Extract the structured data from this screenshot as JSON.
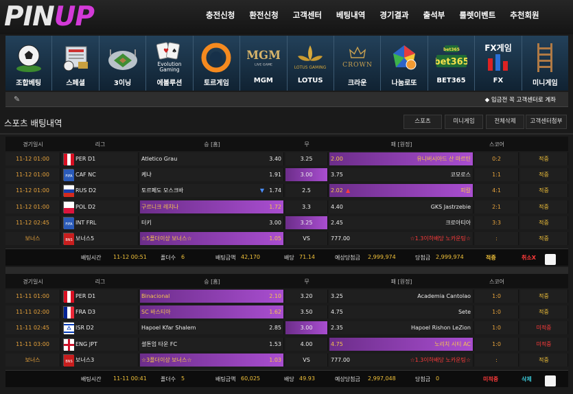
{
  "logo": {
    "part1": "PIN",
    "part2": "UP"
  },
  "top_nav": [
    "충전신청",
    "환전신청",
    "고객센터",
    "베팅내역",
    "경기결과",
    "출석부",
    "룰렛이벤트",
    "추천회원"
  ],
  "games": [
    {
      "label": "조합베팅",
      "icon": "soccer-ball-icon",
      "art": ""
    },
    {
      "label": "스페셜",
      "icon": "scoreboard-icon",
      "art": ""
    },
    {
      "label": "3이닝",
      "icon": "baseball-stadium-icon",
      "art": ""
    },
    {
      "label": "에볼루션",
      "icon": "evolution-gaming-logo",
      "art": "Evolution Gaming"
    },
    {
      "label": "토르게임",
      "icon": "tor-ring-logo",
      "art": ""
    },
    {
      "label": "MGM",
      "icon": "mgm-logo",
      "art": "MGM"
    },
    {
      "label": "LOTUS",
      "icon": "lotus-gaming-logo",
      "art": "LOTUS GAMING"
    },
    {
      "label": "크라운",
      "icon": "crown-logo",
      "art": "CROWN"
    },
    {
      "label": "나눔로또",
      "icon": "lotto-balls-icon",
      "art": ""
    },
    {
      "label": "BET365",
      "icon": "bet365-logo",
      "art": "bet365"
    },
    {
      "label": "FX",
      "icon": "fx-chart-icon",
      "art": "FX게임"
    },
    {
      "label": "미니게임",
      "icon": "ladder-icon",
      "art": ""
    }
  ],
  "notice": "◆ 입금전 꼭 고객센터로 계좌",
  "section_title": "스포츠 배팅내역",
  "tabs": [
    "스포츠",
    "미니게임",
    "전체삭제",
    "고객센터첨부"
  ],
  "headers": {
    "date": "경기일시",
    "league": "리그",
    "home": "승 [홈]",
    "draw": "무",
    "away": "패 [원정]",
    "score": "스코어"
  },
  "colors": {
    "pick": "#a94ed0",
    "accent": "#f2c23a",
    "date": "#e9a43c",
    "fail": "#ff3b3b"
  },
  "slips": [
    {
      "rows": [
        {
          "date": "11-12 01:00",
          "league": "PER D1",
          "flag": "peru",
          "home": "Atletico Grau",
          "home_odd": "3.40",
          "draw": "3.25",
          "away": "유니버시아드 산 마르틴",
          "away_odd": "2.00",
          "score": "0:2",
          "result": "적중",
          "pick": "away",
          "arrow": false
        },
        {
          "date": "11-12 01:00",
          "league": "CAF NC",
          "flag": "fifa",
          "home": "케냐",
          "home_odd": "1.91",
          "draw": "3.00",
          "away": "코모로스",
          "away_odd": "3.75",
          "score": "1:1",
          "result": "적중",
          "pick": "draw",
          "arrow": false
        },
        {
          "date": "11-12 01:00",
          "league": "RUS D2",
          "flag": "russia",
          "home": "토르페도 모스크바",
          "home_odd": "1.74",
          "draw": "2.5",
          "away": "피칼",
          "away_odd": "2.02",
          "score": "4:1",
          "result": "적중",
          "pick": "away",
          "arrow": true
        },
        {
          "date": "11-12 01:00",
          "league": "POL D2",
          "flag": "poland",
          "home": "구르니크 레치나",
          "home_odd": "1.72",
          "draw": "3.3",
          "away": "GKS Jastrzebie",
          "away_odd": "4.40",
          "score": "2:1",
          "result": "적중",
          "pick": "home",
          "arrow": false
        },
        {
          "date": "11-12 02:45",
          "league": "INT FRL",
          "flag": "fifa",
          "home": "터키",
          "home_odd": "3.00",
          "draw": "3.25",
          "away": "크로아티아",
          "away_odd": "2.45",
          "score": "3:3",
          "result": "적중",
          "pick": "draw",
          "arrow": false
        },
        {
          "date": "보너스",
          "league": "보너스5",
          "flag": "bonus",
          "home": "☆5폴더이상 보너스☆",
          "home_odd": "1.05",
          "draw": "VS",
          "away": "☆1.3이하배당 노카운팅☆",
          "away_odd": "777.00",
          "score": ":",
          "result": "적중",
          "pick": "home",
          "arrow": false,
          "bonus": true
        }
      ],
      "summary": {
        "bet_time_label": "배팅시간",
        "bet_time": "11-12 00:51",
        "folders_label": "폴더수",
        "folders": "6",
        "amount_label": "배팅금액",
        "amount": "42,170",
        "odds_label": "배당",
        "odds": "71.14",
        "expected_label": "예상당첨금",
        "expected": "2,999,974",
        "won_label": "당첨금",
        "won": "2,999,974",
        "status": "적중",
        "action": "취소X"
      }
    },
    {
      "rows": [
        {
          "date": "11-11 01:00",
          "league": "PER D1",
          "flag": "peru",
          "home": "Binacional",
          "home_odd": "2.10",
          "draw": "3.20",
          "away": "Academia Cantolao",
          "away_odd": "3.25",
          "score": "1:0",
          "result": "적중",
          "pick": "home",
          "arrow": false
        },
        {
          "date": "11-11 02:00",
          "league": "FRA D3",
          "flag": "france",
          "home": "SC 바스티아",
          "home_odd": "1.62",
          "draw": "3.50",
          "away": "Sete",
          "away_odd": "4.75",
          "score": "1:0",
          "result": "적중",
          "pick": "home",
          "arrow": false
        },
        {
          "date": "11-11 02:45",
          "league": "ISR D2",
          "flag": "israel",
          "home": "Hapoel Kfar Shalem",
          "home_odd": "2.85",
          "draw": "3.00",
          "away": "Hapoel Rishon LeZion",
          "away_odd": "2.35",
          "score": "1:0",
          "result": "미적중",
          "pick": "draw",
          "arrow": false
        },
        {
          "date": "11-11 03:00",
          "league": "ENG JPT",
          "flag": "england",
          "home": "셜톤엄 타운 FC",
          "home_odd": "1.53",
          "draw": "4.00",
          "away": "노리치 시티 AC",
          "away_odd": "4.75",
          "score": "1:0",
          "result": "미적중",
          "pick": "away",
          "arrow": false
        },
        {
          "date": "보너스",
          "league": "보너스3",
          "flag": "bonus",
          "home": "☆3폴더이상 보너스☆",
          "home_odd": "1.03",
          "draw": "VS",
          "away": "☆1.3이하배당 노카운팅☆",
          "away_odd": "777.00",
          "score": ":",
          "result": "적중",
          "pick": "home",
          "arrow": false,
          "bonus": true
        }
      ],
      "summary": {
        "bet_time_label": "배팅시간",
        "bet_time": "11-11 00:41",
        "folders_label": "폴더수",
        "folders": "5",
        "amount_label": "배팅금액",
        "amount": "60,025",
        "odds_label": "배당",
        "odds": "49.93",
        "expected_label": "예상당첨금",
        "expected": "2,997,048",
        "won_label": "당첨금",
        "won": "0",
        "status": "미적중",
        "action": "삭제"
      }
    }
  ]
}
